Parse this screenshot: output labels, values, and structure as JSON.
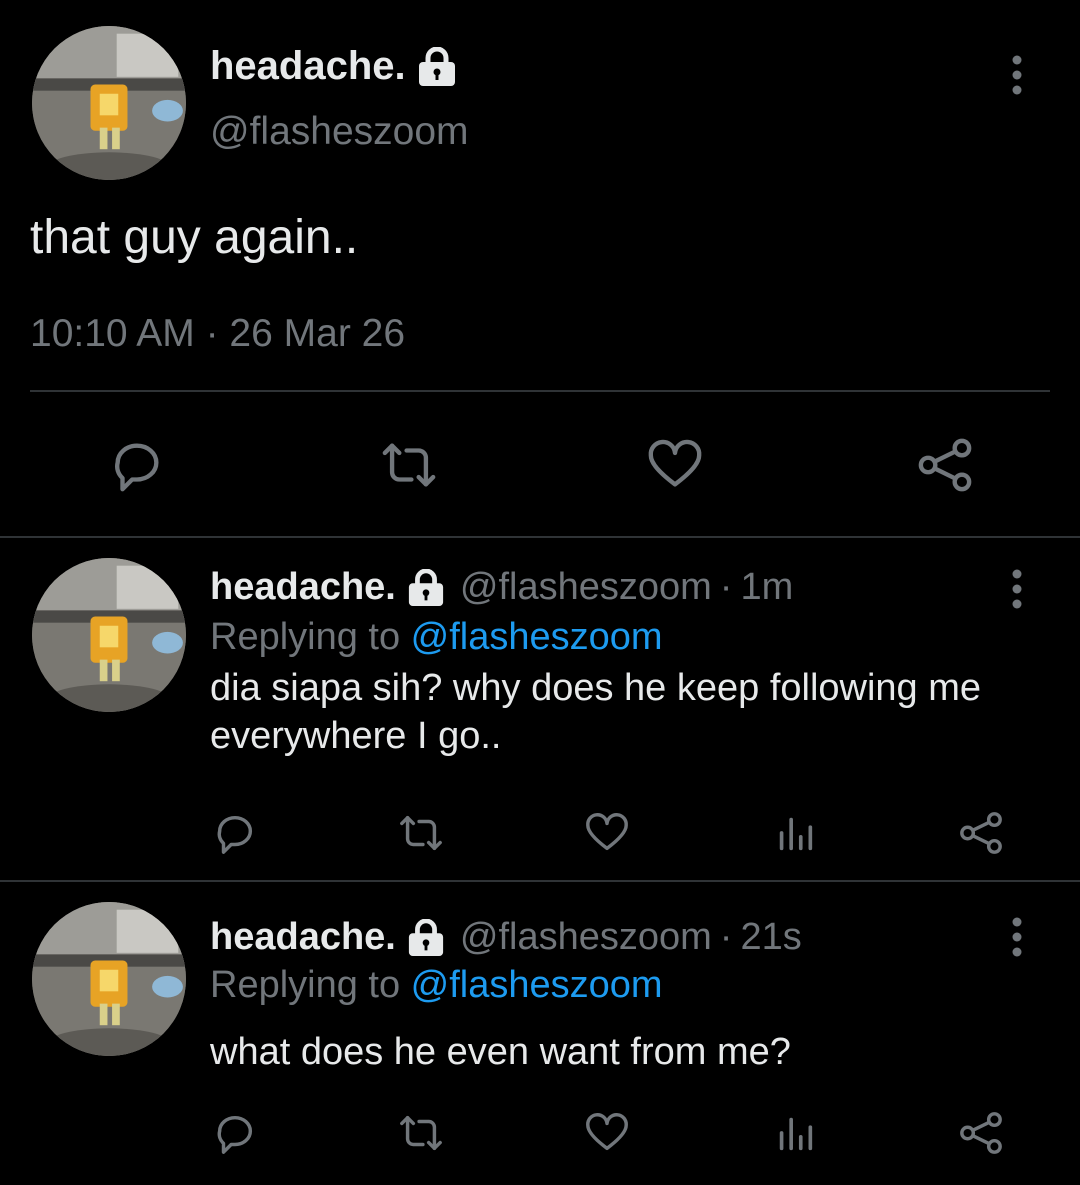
{
  "main_tweet": {
    "display_name": "headache.",
    "handle": "@flasheszoom",
    "text": "that guy again..",
    "timestamp": "10:10 AM · 26 Mar 26",
    "icons": [
      "lock-icon",
      "more-vertical-icon",
      "reply-icon",
      "retweet-icon",
      "like-icon",
      "share-icon"
    ]
  },
  "replies": [
    {
      "display_name": "headache.",
      "handle": "@flasheszoom",
      "separator": "·",
      "time": "1m",
      "replying_prefix": "Replying to ",
      "replying_to": "@flasheszoom",
      "text": "dia siapa sih? why does he keep following me everywhere I go.."
    },
    {
      "display_name": "headache.",
      "handle": "@flasheszoom",
      "separator": "·",
      "time": "21s",
      "replying_prefix": "Replying to ",
      "replying_to": "@flasheszoom",
      "text": "what does he even want from me?"
    }
  ],
  "colors": {
    "background": "#000000",
    "text": "#e7e9ea",
    "secondary": "#71767b",
    "link": "#1d9bf0",
    "divider": "#2f3336"
  }
}
